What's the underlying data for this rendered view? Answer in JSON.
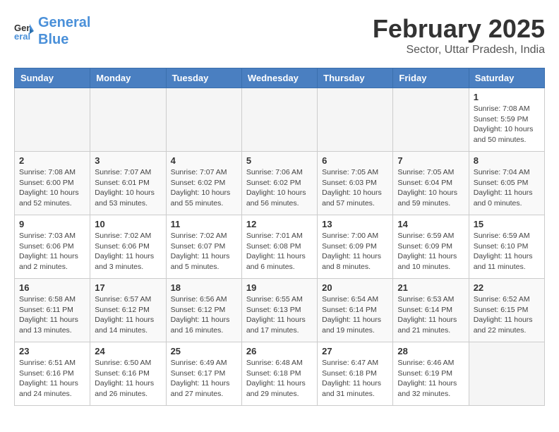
{
  "header": {
    "logo_line1": "General",
    "logo_line2": "Blue",
    "month_title": "February 2025",
    "subtitle": "Sector, Uttar Pradesh, India"
  },
  "days_of_week": [
    "Sunday",
    "Monday",
    "Tuesday",
    "Wednesday",
    "Thursday",
    "Friday",
    "Saturday"
  ],
  "weeks": [
    [
      {
        "num": "",
        "info": ""
      },
      {
        "num": "",
        "info": ""
      },
      {
        "num": "",
        "info": ""
      },
      {
        "num": "",
        "info": ""
      },
      {
        "num": "",
        "info": ""
      },
      {
        "num": "",
        "info": ""
      },
      {
        "num": "1",
        "info": "Sunrise: 7:08 AM\nSunset: 5:59 PM\nDaylight: 10 hours\nand 50 minutes."
      }
    ],
    [
      {
        "num": "2",
        "info": "Sunrise: 7:08 AM\nSunset: 6:00 PM\nDaylight: 10 hours\nand 52 minutes."
      },
      {
        "num": "3",
        "info": "Sunrise: 7:07 AM\nSunset: 6:01 PM\nDaylight: 10 hours\nand 53 minutes."
      },
      {
        "num": "4",
        "info": "Sunrise: 7:07 AM\nSunset: 6:02 PM\nDaylight: 10 hours\nand 55 minutes."
      },
      {
        "num": "5",
        "info": "Sunrise: 7:06 AM\nSunset: 6:02 PM\nDaylight: 10 hours\nand 56 minutes."
      },
      {
        "num": "6",
        "info": "Sunrise: 7:05 AM\nSunset: 6:03 PM\nDaylight: 10 hours\nand 57 minutes."
      },
      {
        "num": "7",
        "info": "Sunrise: 7:05 AM\nSunset: 6:04 PM\nDaylight: 10 hours\nand 59 minutes."
      },
      {
        "num": "8",
        "info": "Sunrise: 7:04 AM\nSunset: 6:05 PM\nDaylight: 11 hours\nand 0 minutes."
      }
    ],
    [
      {
        "num": "9",
        "info": "Sunrise: 7:03 AM\nSunset: 6:06 PM\nDaylight: 11 hours\nand 2 minutes."
      },
      {
        "num": "10",
        "info": "Sunrise: 7:02 AM\nSunset: 6:06 PM\nDaylight: 11 hours\nand 3 minutes."
      },
      {
        "num": "11",
        "info": "Sunrise: 7:02 AM\nSunset: 6:07 PM\nDaylight: 11 hours\nand 5 minutes."
      },
      {
        "num": "12",
        "info": "Sunrise: 7:01 AM\nSunset: 6:08 PM\nDaylight: 11 hours\nand 6 minutes."
      },
      {
        "num": "13",
        "info": "Sunrise: 7:00 AM\nSunset: 6:09 PM\nDaylight: 11 hours\nand 8 minutes."
      },
      {
        "num": "14",
        "info": "Sunrise: 6:59 AM\nSunset: 6:09 PM\nDaylight: 11 hours\nand 10 minutes."
      },
      {
        "num": "15",
        "info": "Sunrise: 6:59 AM\nSunset: 6:10 PM\nDaylight: 11 hours\nand 11 minutes."
      }
    ],
    [
      {
        "num": "16",
        "info": "Sunrise: 6:58 AM\nSunset: 6:11 PM\nDaylight: 11 hours\nand 13 minutes."
      },
      {
        "num": "17",
        "info": "Sunrise: 6:57 AM\nSunset: 6:12 PM\nDaylight: 11 hours\nand 14 minutes."
      },
      {
        "num": "18",
        "info": "Sunrise: 6:56 AM\nSunset: 6:12 PM\nDaylight: 11 hours\nand 16 minutes."
      },
      {
        "num": "19",
        "info": "Sunrise: 6:55 AM\nSunset: 6:13 PM\nDaylight: 11 hours\nand 17 minutes."
      },
      {
        "num": "20",
        "info": "Sunrise: 6:54 AM\nSunset: 6:14 PM\nDaylight: 11 hours\nand 19 minutes."
      },
      {
        "num": "21",
        "info": "Sunrise: 6:53 AM\nSunset: 6:14 PM\nDaylight: 11 hours\nand 21 minutes."
      },
      {
        "num": "22",
        "info": "Sunrise: 6:52 AM\nSunset: 6:15 PM\nDaylight: 11 hours\nand 22 minutes."
      }
    ],
    [
      {
        "num": "23",
        "info": "Sunrise: 6:51 AM\nSunset: 6:16 PM\nDaylight: 11 hours\nand 24 minutes."
      },
      {
        "num": "24",
        "info": "Sunrise: 6:50 AM\nSunset: 6:16 PM\nDaylight: 11 hours\nand 26 minutes."
      },
      {
        "num": "25",
        "info": "Sunrise: 6:49 AM\nSunset: 6:17 PM\nDaylight: 11 hours\nand 27 minutes."
      },
      {
        "num": "26",
        "info": "Sunrise: 6:48 AM\nSunset: 6:18 PM\nDaylight: 11 hours\nand 29 minutes."
      },
      {
        "num": "27",
        "info": "Sunrise: 6:47 AM\nSunset: 6:18 PM\nDaylight: 11 hours\nand 31 minutes."
      },
      {
        "num": "28",
        "info": "Sunrise: 6:46 AM\nSunset: 6:19 PM\nDaylight: 11 hours\nand 32 minutes."
      },
      {
        "num": "",
        "info": ""
      }
    ]
  ]
}
